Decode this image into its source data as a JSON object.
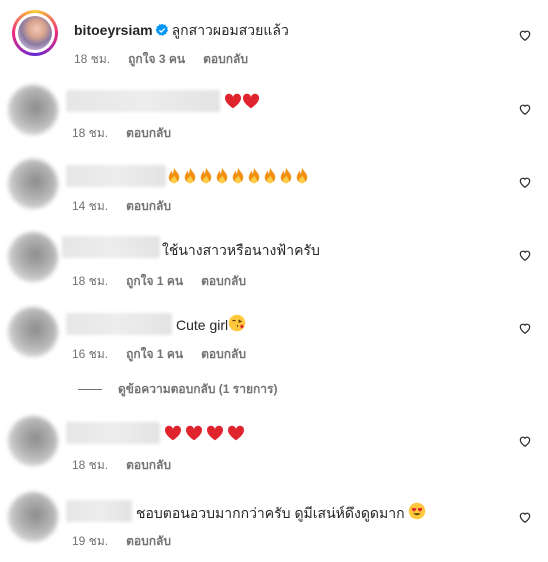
{
  "colors": {
    "text": "#262626",
    "secondary": "#737373",
    "verified": "#0095f6",
    "heart_emoji": "#e0242e"
  },
  "icons": {
    "like": "heart-outline-icon",
    "verified": "verified-badge-icon"
  },
  "comments": [
    {
      "username": "bitoeyrsiam",
      "text": "ลูกสาวผอมสวยแล้ว",
      "time": "18 ชม.",
      "likes": "ถูกใจ 3 คน",
      "reply": "ตอบกลับ"
    },
    {
      "text": "",
      "emoji_count": 2,
      "time": "18 ชม.",
      "reply": "ตอบกลับ"
    },
    {
      "text": "",
      "emoji_count": 9,
      "time": "14 ชม.",
      "reply": "ตอบกลับ"
    },
    {
      "text": "ใช้นางสาวหรือนางฟ้าครับ",
      "time": "18 ชม.",
      "likes": "ถูกใจ 1 คน",
      "reply": "ตอบกลับ"
    },
    {
      "text": "Cute girl",
      "time": "16 ชม.",
      "likes": "ถูกใจ 1 คน",
      "reply": "ตอบกลับ"
    },
    {
      "text": "",
      "emoji_count": 4,
      "time": "18 ชม.",
      "reply": "ตอบกลับ"
    },
    {
      "text": "ชอบตอนอวบมากกว่าครับ ดูมีเสน่ห์ดึงดูดมาก",
      "time": "19 ชม.",
      "reply": "ตอบกลับ"
    }
  ],
  "view_replies": "ดูข้อความตอบกลับ (1 รายการ)"
}
